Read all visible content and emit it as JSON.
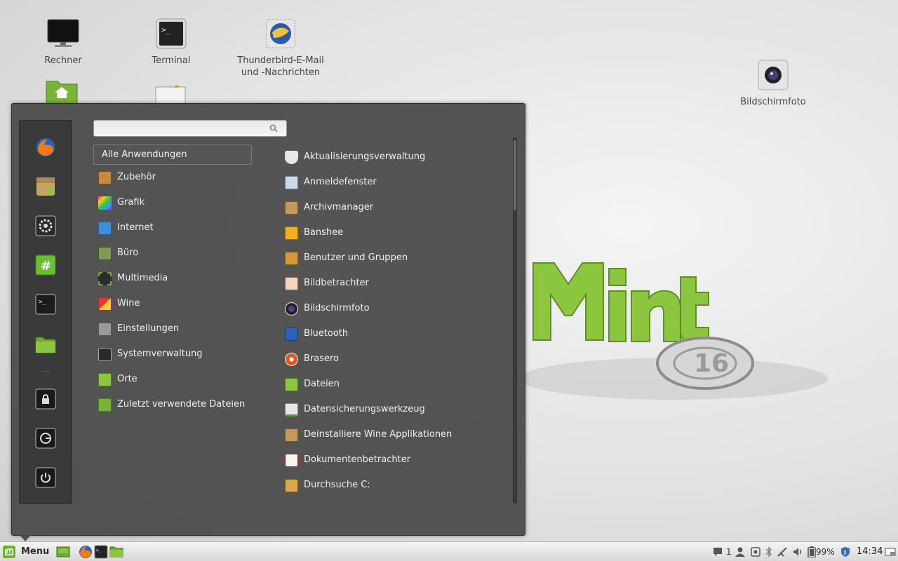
{
  "desktop": {
    "icons": [
      {
        "label": "Rechner",
        "icon": "monitor-icon"
      },
      {
        "label": "Terminal",
        "icon": "terminal-icon"
      },
      {
        "label": "Thunderbird-E-Mail und -Nachrichten",
        "icon": "thunderbird-icon"
      },
      {
        "label": "Bildschirmfoto",
        "icon": "camera-icon"
      }
    ]
  },
  "menu": {
    "search": {
      "value": "",
      "placeholder": ""
    },
    "favorites": [
      "firefox-icon",
      "software-manager-icon",
      "system-settings-icon",
      "hashtag-terminal-icon",
      "terminal-icon",
      "folder-icon"
    ],
    "session": [
      "lock-icon",
      "logout-icon",
      "power-icon"
    ],
    "categories": [
      {
        "label": "Alle Anwendungen"
      },
      {
        "label": "Zubehör",
        "icon": "calculator-icon"
      },
      {
        "label": "Grafik",
        "icon": "palette-icon"
      },
      {
        "label": "Internet",
        "icon": "network-icon"
      },
      {
        "label": "Büro",
        "icon": "chart-icon"
      },
      {
        "label": "Multimedia",
        "icon": "film-icon"
      },
      {
        "label": "Wine",
        "icon": "wine-icon"
      },
      {
        "label": "Einstellungen",
        "icon": "sliders-icon"
      },
      {
        "label": "Systemverwaltung",
        "icon": "gear-icon"
      },
      {
        "label": "Orte",
        "icon": "folder-icon"
      },
      {
        "label": "Zuletzt verwendete  Dateien",
        "icon": "recent-folder-icon"
      }
    ],
    "applications": [
      {
        "label": "Aktualisierungsverwaltung",
        "icon": "shield-icon"
      },
      {
        "label": "Anmeldefenster",
        "icon": "login-window-icon"
      },
      {
        "label": "Archivmanager",
        "icon": "archive-icon"
      },
      {
        "label": "Banshee",
        "icon": "banshee-icon"
      },
      {
        "label": "Benutzer und Gruppen",
        "icon": "users-icon"
      },
      {
        "label": "Bildbetrachter",
        "icon": "eye-icon"
      },
      {
        "label": "Bildschirmfoto",
        "icon": "camera-icon"
      },
      {
        "label": "Bluetooth",
        "icon": "bluetooth-icon"
      },
      {
        "label": "Brasero",
        "icon": "disc-icon"
      },
      {
        "label": "Dateien",
        "icon": "folder-icon"
      },
      {
        "label": "Datensicherungswerkzeug",
        "icon": "backup-icon"
      },
      {
        "label": "Deinstalliere Wine Applikationen",
        "icon": "uninstall-icon"
      },
      {
        "label": "Dokumentenbetrachter",
        "icon": "document-viewer-icon"
      },
      {
        "label": "Durchsuche C:",
        "icon": "browse-drive-icon"
      }
    ]
  },
  "panel": {
    "menu_label": "Menu",
    "notification_count": "1",
    "battery": "99%",
    "clock": "14:34"
  },
  "colors": {
    "menu_bg": "#484848",
    "mint_green": "#8cc63f",
    "panel_bg": "#e6e6e6"
  }
}
